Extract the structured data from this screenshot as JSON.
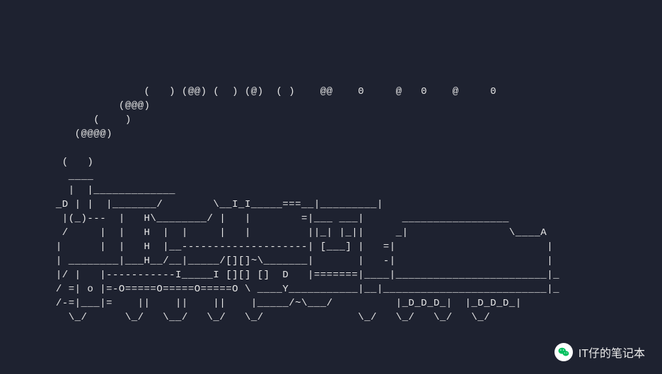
{
  "terminal": {
    "ascii_art": "               (   ) (@@) (  ) (@)  ( )    @@    0     @   0    @     0\n           (@@@)\n       (    )\n    (@@@@)\n\n  (   )\n   ____\n   |  |_____________\n _D | |  |_______/        \\__I_I_____===__|_________|\n  |(_)---  |   H\\________/ |   |        =|___ ___|      _________________\n  /     |  |   H  |  |     |   |         ||_| |_||     _|                \\____A\n |      |  |   H  |__--------------------| [___] |   =|                        |\n | ________|___H__/__|_____/[][]~\\_______|       |   -|                        |\n |/ |   |-----------I_____I [][] []  D   |=======|____|________________________|_\n / =| o |=-O=====O=====O=====O \\ ____Y___________|__|__________________________|_\n /-=|___|=    ||    ||    ||    |_____/~\\___/          |_D_D_D_|  |_D_D_D_|\n   \\_/      \\_/   \\__/   \\_/   \\_/               \\_/   \\_/   \\_/   \\_/"
  },
  "watermark": {
    "text": "IT仔的笔记本",
    "icon_name": "wechat-icon"
  }
}
